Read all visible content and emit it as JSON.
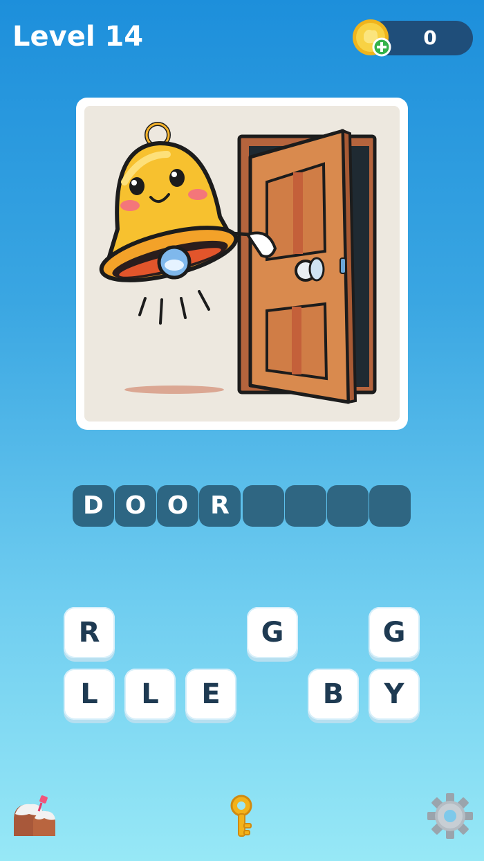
{
  "header": {
    "level_label": "Level 14",
    "coins": "0"
  },
  "icons": {
    "coin": "coin-plus-icon",
    "shop": "shop-icon",
    "hint": "key-icon",
    "settings": "gear-icon"
  },
  "picture": {
    "subject": "bell-and-door"
  },
  "answer": {
    "slots": [
      "D",
      "O",
      "O",
      "R",
      "",
      "",
      "",
      ""
    ]
  },
  "letters": {
    "row1": [
      "R",
      "",
      "",
      "G",
      "",
      "G"
    ],
    "row2": [
      "L",
      "L",
      "E",
      "",
      "B",
      "Y"
    ]
  },
  "colors": {
    "slot_bg": "#2d6683",
    "tile_bg": "#ffffff",
    "tile_text": "#1e3a52",
    "coin_box": "#1f4e7a"
  }
}
